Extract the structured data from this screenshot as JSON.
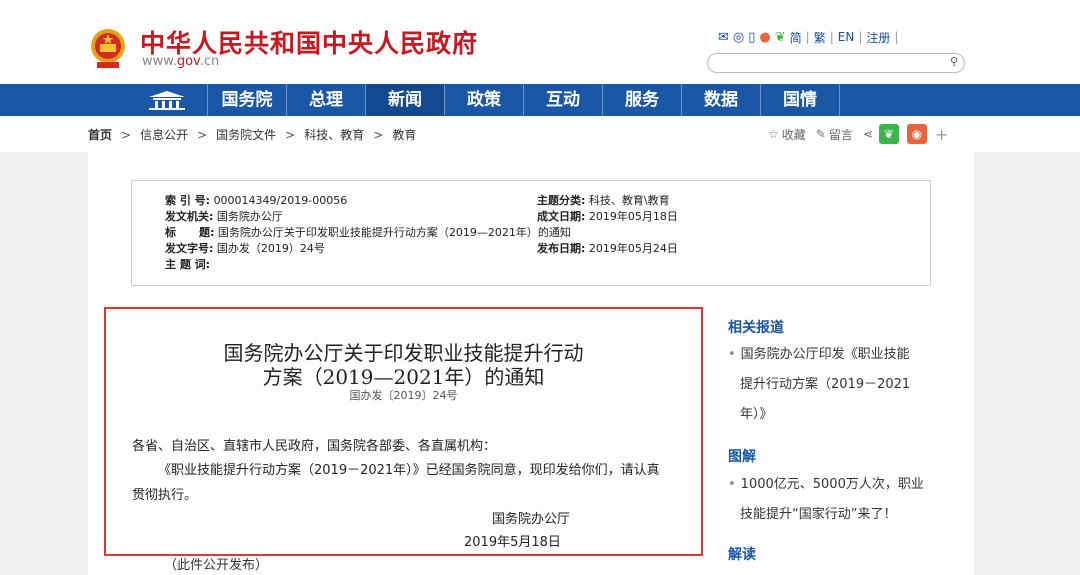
{
  "header": {
    "site_title": "中华人民共和国中央人民政府",
    "site_url_pre": "www.",
    "site_url_gov": "gov",
    "site_url_post": ".cn",
    "icons": [
      "mail-icon",
      "chat-icon",
      "mobile-icon",
      "weibo-icon",
      "wechat-icon"
    ],
    "lang_links": [
      "简",
      "繁",
      "EN",
      "注册"
    ]
  },
  "nav": {
    "items": [
      "国务院",
      "总理",
      "新闻",
      "政策",
      "互动",
      "服务",
      "数据",
      "国情"
    ],
    "active": "新闻"
  },
  "breadcrumb": {
    "items": [
      "首页",
      "信息公开",
      "国务院文件",
      "科技、教育",
      "教育"
    ]
  },
  "actions": {
    "favorite": "收藏",
    "comment": "留言"
  },
  "meta": {
    "index_no_label": "索 引 号:",
    "index_no": "000014349/2019-00056",
    "category_label": "主题分类:",
    "category": "科技、教育\\教育",
    "issuer_label": "发文机关:",
    "issuer": "国务院办公厅",
    "written_label": "成文日期:",
    "written": "2019年05月18日",
    "title_label": "标      题:",
    "title": "国务院办公厅关于印发职业技能提升行动方案（2019—2021年）的通知",
    "doc_no_label": "发文字号:",
    "doc_no": "国办发（2019）24号",
    "published_label": "发布日期:",
    "published": "2019年05月24日",
    "keywords_label": "主 题 词:"
  },
  "document": {
    "title_line1": "国务院办公厅关于印发职业技能提升行动",
    "title_line2": "方案（2019—2021年）的通知",
    "doc_number": "国办发〔2019〕24号",
    "addressee": "各省、自治区、直辖市人民政府，国务院各部委、各直属机构：",
    "body_line1": "《职业技能提升行动方案（2019－2021年）》已经国务院同意，现印发给你们，请认真",
    "body_line2": "贯彻执行。",
    "signer": "国务院办公厅",
    "date": "2019年5月18日",
    "note": "（此件公开发布）"
  },
  "sidebar": {
    "related_head": "相关报道",
    "related_lines": [
      "国务院办公厅印发《职业技能",
      "提升行动方案（2019－2021",
      "年）》"
    ],
    "graphic_head": "图解",
    "graphic_lines": [
      "1000亿元、5000万人次，职业",
      "技能提升“国家行动”来了！"
    ],
    "interpret_head": "解读"
  }
}
